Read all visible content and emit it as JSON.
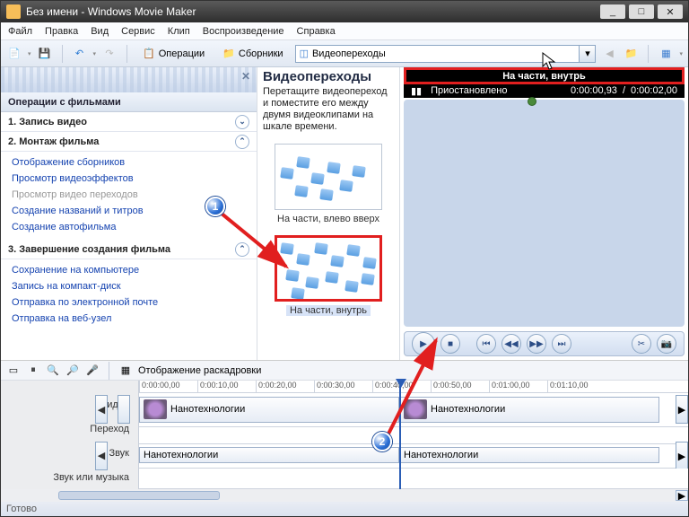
{
  "window": {
    "title": "Без имени - Windows Movie Maker"
  },
  "window_controls": {
    "min": "_",
    "max": "□",
    "close": "✕"
  },
  "menu": {
    "items": [
      "Файл",
      "Правка",
      "Вид",
      "Сервис",
      "Клип",
      "Воспроизведение",
      "Справка"
    ]
  },
  "toolbar": {
    "operations": "Операции",
    "collections": "Сборники",
    "dropdown_value": "Видеопереходы"
  },
  "taskpane": {
    "header": "Операции с фильмами",
    "sections": [
      {
        "title": "1. Запись видео",
        "links": []
      },
      {
        "title": "2. Монтаж фильма",
        "links": [
          {
            "label": "Отображение сборников",
            "disabled": false
          },
          {
            "label": "Просмотр видеоэффектов",
            "disabled": false
          },
          {
            "label": "Просмотр видео переходов",
            "disabled": true
          },
          {
            "label": "Создание названий и титров",
            "disabled": false
          },
          {
            "label": "Создание автофильма",
            "disabled": false
          }
        ]
      },
      {
        "title": "3. Завершение создания фильма",
        "links": [
          {
            "label": "Сохранение на компьютере",
            "disabled": false
          },
          {
            "label": "Запись на компакт-диск",
            "disabled": false
          },
          {
            "label": "Отправка по электронной почте",
            "disabled": false
          },
          {
            "label": "Отправка на веб-узел",
            "disabled": false
          }
        ]
      }
    ]
  },
  "transitions": {
    "title": "Видеопереходы",
    "description": "Перетащите видеопереход и поместите его между двумя видеоклипами на шкале времени.",
    "items": [
      {
        "caption": "На части, влево вверх",
        "selected": false
      },
      {
        "caption": "На части, внутрь",
        "selected": true
      }
    ]
  },
  "preview": {
    "title": "На части, внутрь",
    "status": "Приостановлено",
    "time_elapsed": "0:00:00,93",
    "time_total": "0:00:02,00"
  },
  "timeline": {
    "toolbar_label": "Отображение раскадровки",
    "ruler": [
      "0:00:00,00",
      "0:00:10,00",
      "0:00:20,00",
      "0:00:30,00",
      "0:00:40,00",
      "0:00:50,00",
      "0:01:00,00",
      "0:01:10,00"
    ],
    "tracks": {
      "video": "Видео",
      "transition": "Переход",
      "audio": "Звук",
      "music": "Звук или музыка"
    },
    "clips": {
      "video1": "Нанотехнологии",
      "video2": "Нанотехнологии",
      "audio1": "Нанотехнологии",
      "audio2": "Нанотехнологии"
    }
  },
  "status": {
    "text": "Готово"
  },
  "markers": {
    "m1": "1",
    "m2": "2"
  }
}
